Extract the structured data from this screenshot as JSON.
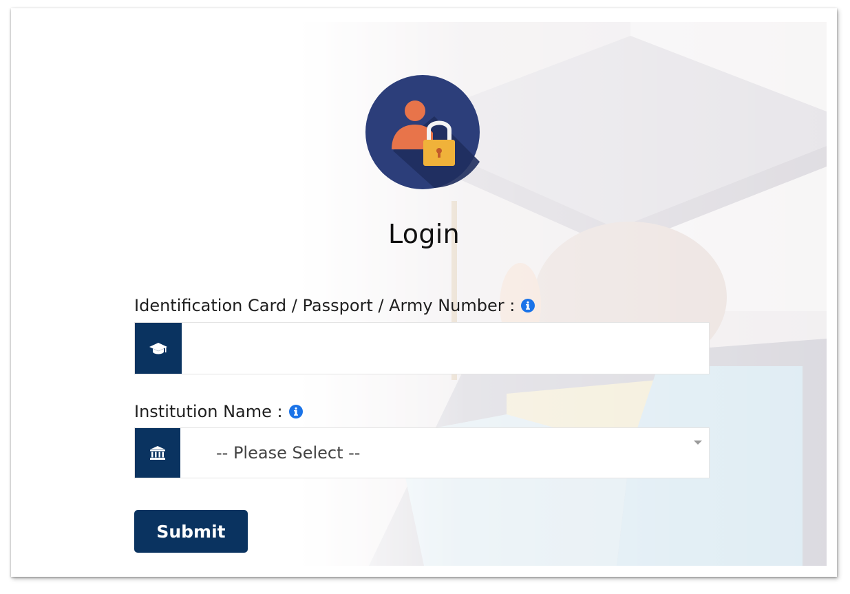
{
  "login": {
    "title": "Login",
    "id_field": {
      "label": "Identification Card / Passport / Army Number :",
      "value": "",
      "placeholder": ""
    },
    "institution_field": {
      "label": "Institution Name :",
      "selected": "-- Please Select --"
    },
    "submit_label": "Submit"
  },
  "icons": {
    "logo": "user-lock-icon",
    "id_info": "info-circle-icon",
    "id_addon": "graduation-cap-icon",
    "institution_info": "info-circle-icon",
    "institution_addon": "university-building-icon",
    "select_caret": "caret-down-icon"
  },
  "colors": {
    "accent": "#0a3360",
    "info": "#1a73e8",
    "logo_circle": "#2c3e7a",
    "logo_user": "#e8744a",
    "logo_lock": "#f0b23a"
  }
}
